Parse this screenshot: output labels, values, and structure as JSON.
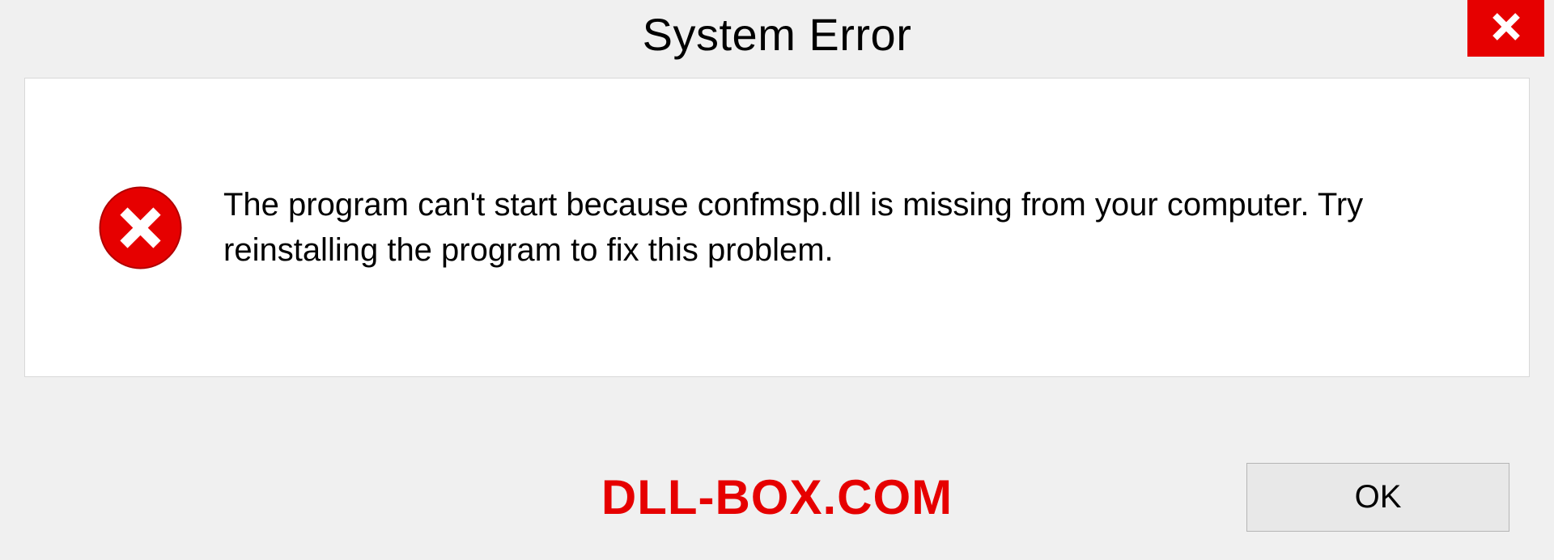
{
  "dialog": {
    "title": "System Error",
    "message": "The program can't start because confmsp.dll is missing from your computer. Try reinstalling the program to fix this problem.",
    "ok_label": "OK"
  },
  "watermark": "DLL-BOX.COM",
  "colors": {
    "accent_red": "#e60000",
    "panel_bg": "#ffffff",
    "window_bg": "#f0f0f0"
  }
}
